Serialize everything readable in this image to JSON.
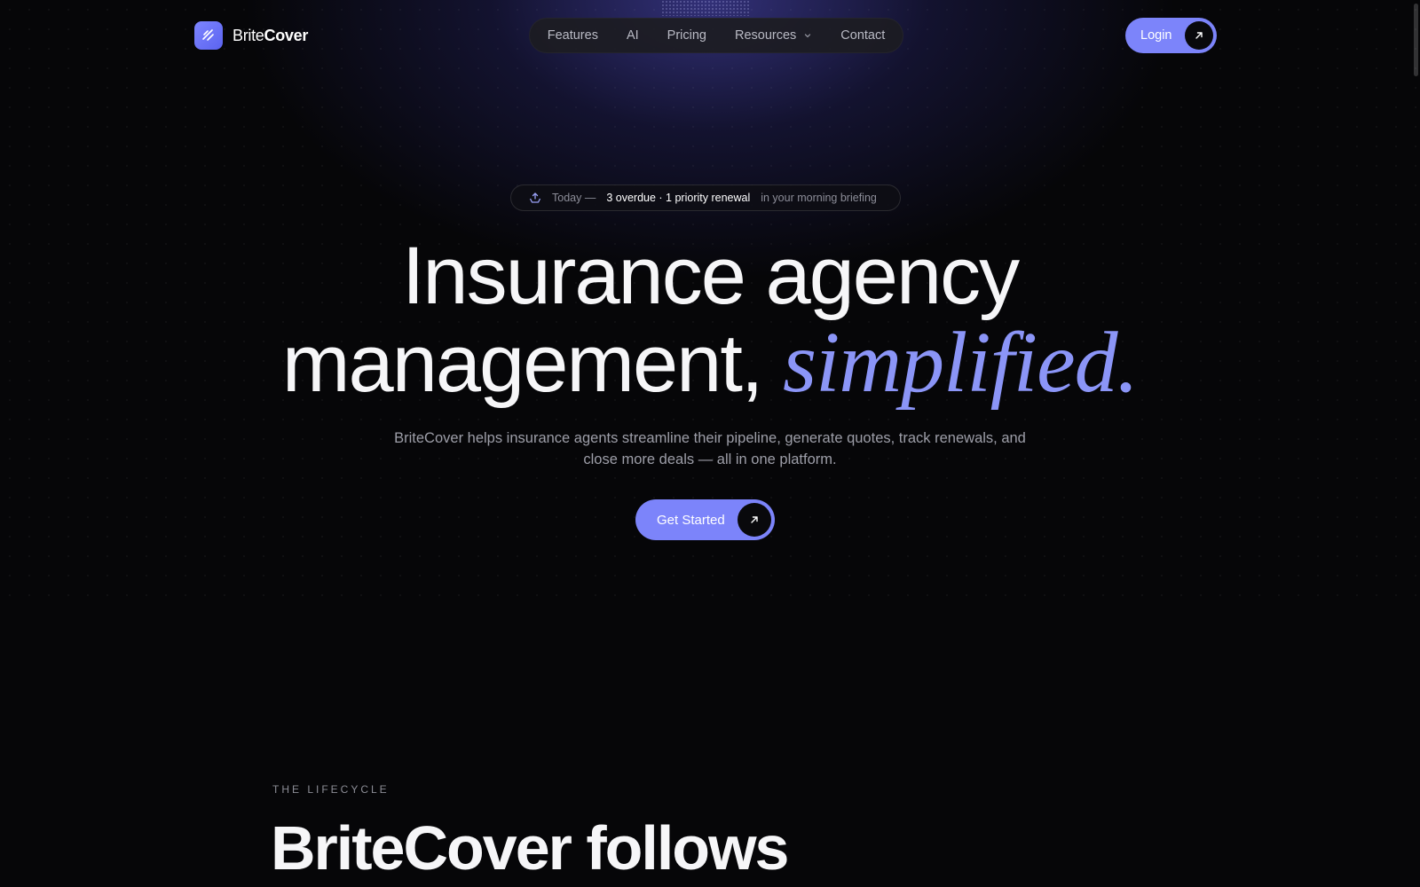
{
  "brand": {
    "name_light": "Brite",
    "name_bold": "Cover",
    "icon": "logo-slashes-icon",
    "accent_color": "#7c84fa"
  },
  "nav": {
    "items": [
      {
        "label": "Features"
      },
      {
        "label": "AI"
      },
      {
        "label": "Pricing"
      },
      {
        "label": "Resources",
        "has_dropdown": true
      },
      {
        "label": "Contact"
      }
    ],
    "login_label": "Login"
  },
  "briefing": {
    "icon": "inbox-upload-icon",
    "prefix": "Today —",
    "highlight": "3 overdue · 1 priority renewal",
    "suffix": "in your morning briefing"
  },
  "hero": {
    "headline_line1": "Insurance agency",
    "headline_line2": "management,",
    "headline_accent": "simplified.",
    "subtext": "BriteCover helps insurance agents streamline their pipeline, generate quotes, track renewals, and close more deals — all in one platform.",
    "cta_label": "Get Started"
  },
  "lifecycle": {
    "eyebrow": "THE LIFECYCLE",
    "title": "BriteCover follows"
  }
}
